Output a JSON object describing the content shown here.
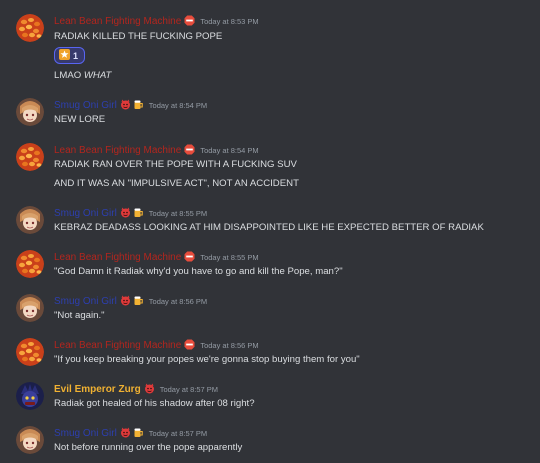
{
  "colors": {
    "background": "#313338",
    "lean_name": "#b3261e",
    "smug_name": "#2d3fae",
    "zurg_name": "#f0b132",
    "text": "#dbdee1",
    "timestamp": "#949ba4",
    "reaction_bg": "#373a6c",
    "reaction_border": "#5865f2"
  },
  "messages": [
    {
      "author": "Lean Bean Fighting Machine",
      "badges": [
        "stop-sign-badge-icon"
      ],
      "timestamp": "Today at 8:53 PM",
      "lines": [
        "RADIAK KILLED THE FUCKING POPE"
      ],
      "reaction": {
        "emoji": "star-icon",
        "count": "1"
      },
      "extra_line_prefix": "LMAO ",
      "extra_line_em": "WHAT"
    },
    {
      "author": "Smug Oni Girl",
      "badges": [
        "devil-icon",
        "beer-icon"
      ],
      "timestamp": "Today at 8:54 PM",
      "lines": [
        "NEW LORE"
      ]
    },
    {
      "author": "Lean Bean Fighting Machine",
      "badges": [
        "stop-sign-badge-icon"
      ],
      "timestamp": "Today at 8:54 PM",
      "lines": [
        "RADIAK RAN OVER THE POPE WITH A FUCKING SUV",
        "AND IT WAS AN \"IMPULSIVE ACT\", NOT AN ACCIDENT"
      ]
    },
    {
      "author": "Smug Oni Girl",
      "badges": [
        "devil-icon",
        "beer-icon"
      ],
      "timestamp": "Today at 8:55 PM",
      "lines": [
        "KEBRAZ DEADASS LOOKING AT HIM DISAPPOINTED LIKE HE EXPECTED BETTER OF RADIAK"
      ]
    },
    {
      "author": "Lean Bean Fighting Machine",
      "badges": [
        "stop-sign-badge-icon"
      ],
      "timestamp": "Today at 8:55 PM",
      "lines": [
        "\"God Damn it Radiak why'd you have to go and kill the Pope, man?\""
      ]
    },
    {
      "author": "Smug Oni Girl",
      "badges": [
        "devil-icon",
        "beer-icon"
      ],
      "timestamp": "Today at 8:56 PM",
      "lines": [
        "\"Not again.\""
      ]
    },
    {
      "author": "Lean Bean Fighting Machine",
      "badges": [
        "stop-sign-badge-icon"
      ],
      "timestamp": "Today at 8:56 PM",
      "lines": [
        "\"If you keep breaking your popes we're gonna stop buying them for you\""
      ]
    },
    {
      "author": "Evil Emperor Zurg",
      "badges": [
        "devil-icon"
      ],
      "timestamp": "Today at 8:57 PM",
      "lines": [
        "Radiak got healed of his shadow after 08 right?"
      ]
    },
    {
      "author": "Smug Oni Girl",
      "badges": [
        "devil-icon",
        "beer-icon"
      ],
      "timestamp": "Today at 8:57 PM",
      "lines": [
        "Not before running over the pope apparently"
      ]
    }
  ]
}
